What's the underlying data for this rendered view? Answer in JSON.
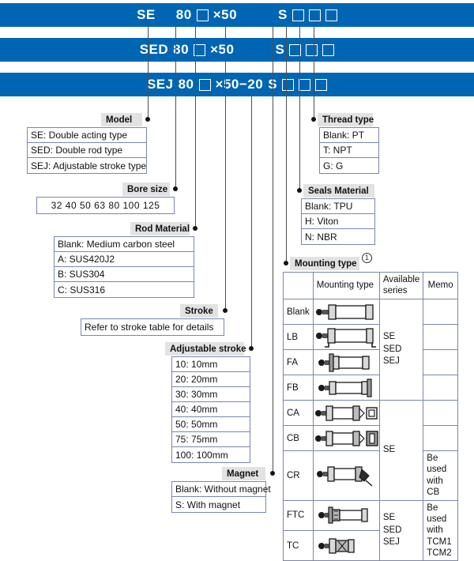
{
  "code_bars": [
    {
      "id": "se",
      "parts": [
        "SE",
        "80",
        "□",
        "×50",
        "S",
        "□",
        "□",
        "□"
      ],
      "display": "SE 80 □ ×50   S □ □ □"
    },
    {
      "id": "sed",
      "parts": [
        "SED",
        "80",
        "□",
        "×50",
        "S",
        "□",
        "□",
        "□"
      ],
      "display": "SED80 □ ×50   S □ □ □"
    },
    {
      "id": "sej",
      "parts": [
        "SEJ",
        "80",
        "□",
        "×50",
        "−20",
        "S",
        "□",
        "□",
        "□"
      ],
      "display": "SEJ 80 □ ×50−20 S □ □ □"
    }
  ],
  "callouts": {
    "model": {
      "label": "Model",
      "options": [
        "SE: Double acting type",
        "SED: Double rod type",
        "SEJ: Adjustable stroke type"
      ]
    },
    "bore_size": {
      "label": "Bore size",
      "options": [
        "32  40  50  63  80  100  125"
      ]
    },
    "rod_material": {
      "label": "Rod Material",
      "options": [
        "Blank: Medium carbon steel",
        "A: SUS420J2",
        "B: SUS304",
        "C: SUS316"
      ]
    },
    "stroke": {
      "label": "Stroke",
      "options": [
        "Refer to stroke table for details"
      ]
    },
    "adjustable_stroke": {
      "label": "Adjustable stroke",
      "options": [
        "10: 10mm",
        "20: 20mm",
        "30: 30mm",
        "40: 40mm",
        "50: 50mm",
        "75: 75mm",
        "100: 100mm"
      ]
    },
    "magnet": {
      "label": "Magnet",
      "options": [
        "Blank: Without magnet",
        "S: With magnet"
      ]
    },
    "thread_type": {
      "label": "Thread type",
      "options": [
        "Blank: PT",
        "T: NPT",
        "G: G"
      ]
    },
    "seals_material": {
      "label": "Seals Material",
      "options": [
        "Blank: TPU",
        "H: Viton",
        "N: NBR"
      ]
    },
    "mounting_type": {
      "label": "Mounting type",
      "note_marker": "1"
    }
  },
  "mounting_table": {
    "headers": [
      "",
      "Mounting type",
      "Available series",
      "Memo"
    ],
    "rows": [
      {
        "code": "Blank",
        "icon": "cylinder-plain",
        "series": "",
        "memo": ""
      },
      {
        "code": "LB",
        "icon": "cylinder-foot",
        "series": "SE\nSED\nSEJ",
        "memo": ""
      },
      {
        "code": "FA",
        "icon": "cylinder-front-flange",
        "series": "",
        "memo": ""
      },
      {
        "code": "FB",
        "icon": "cylinder-rear-flange",
        "series": "",
        "memo": ""
      },
      {
        "code": "CA",
        "icon": "cylinder-clevis-a",
        "series": "SE",
        "memo": ""
      },
      {
        "code": "CB",
        "icon": "cylinder-clevis-b",
        "series": "",
        "memo": ""
      },
      {
        "code": "CR",
        "icon": "cylinder-rod-clevis",
        "series": "",
        "memo": "Be used with CB"
      },
      {
        "code": "FTC",
        "icon": "cylinder-ftc",
        "series": "SE\nSED\nSEJ",
        "memo": "Be used with TCM1 TCM2"
      },
      {
        "code": "TC",
        "icon": "cylinder-tc",
        "series": "",
        "memo": ""
      }
    ],
    "series_groups": [
      {
        "text": "SE\nSED\nSEJ",
        "start": 0,
        "span": 4
      },
      {
        "text": "SE",
        "start": 4,
        "span": 3
      },
      {
        "text": "SE\nSED\nSEJ",
        "start": 7,
        "span": 2
      }
    ],
    "memo_groups": [
      {
        "text": "Be used with CB",
        "start": 6,
        "span": 1
      },
      {
        "text": "Be used with TCM1 TCM2",
        "start": 7,
        "span": 2
      }
    ]
  },
  "colors": {
    "bar_blue": "#0066b3",
    "chip_gray": "#e2e2e2",
    "box_border": "#7a86ad",
    "line_gray": "#4d4d4d"
  }
}
